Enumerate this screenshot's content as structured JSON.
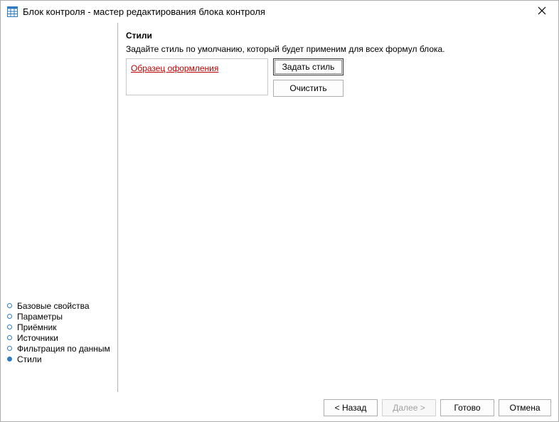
{
  "window": {
    "title": "Блок контроля - мастер редактирования блока контроля",
    "app_icon": "table-grid-icon",
    "close_icon": "close-icon",
    "accent_color": "#2f7bc1"
  },
  "sidebar": {
    "items": [
      {
        "label": "Базовые свойства",
        "active": false
      },
      {
        "label": "Параметры",
        "active": false
      },
      {
        "label": "Приёмник",
        "active": false
      },
      {
        "label": "Источники",
        "active": false
      },
      {
        "label": "Фильтрация по данным",
        "active": false
      },
      {
        "label": "Стили",
        "active": true
      }
    ]
  },
  "main": {
    "section_title": "Стили",
    "description": "Задайте стиль по умолчанию, который будет применим для всех формул блока.",
    "preview_text": "Образец оформления",
    "preview_color": "#c00000",
    "set_style_label": "Задать стиль",
    "clear_label": "Очистить"
  },
  "footer": {
    "back_label": "< Назад",
    "next_label": "Далее >",
    "done_label": "Готово",
    "cancel_label": "Отмена"
  }
}
